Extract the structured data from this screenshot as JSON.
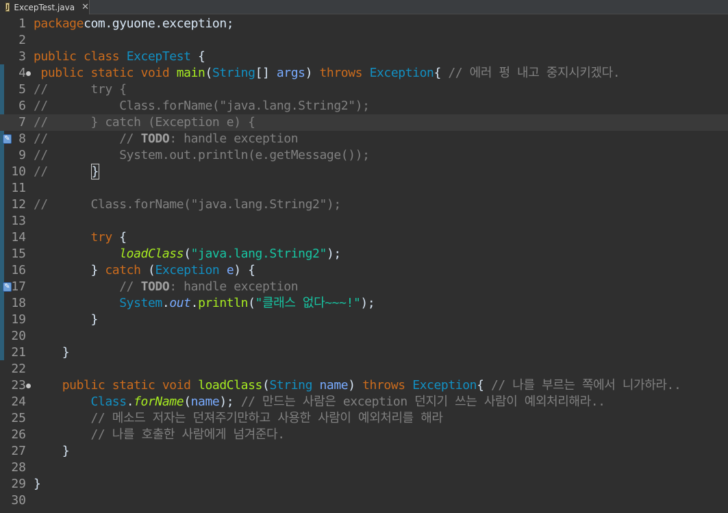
{
  "tab": {
    "title": "ExcepTest.java",
    "close": "✕",
    "icon": "J"
  },
  "lines": [
    {
      "n": "1",
      "t": [
        [
          "kw",
          "package"
        ],
        [
          "",
          "com.gyuone.exception;"
        ]
      ]
    },
    {
      "n": "2",
      "t": []
    },
    {
      "n": "3",
      "t": [
        [
          "kw",
          "public class"
        ],
        [
          "",
          " "
        ],
        [
          "cl",
          "ExcepTest"
        ],
        [
          "",
          " {"
        ]
      ]
    },
    {
      "n": "4",
      "fold": true,
      "t": [
        [
          "",
          " "
        ],
        [
          "kw",
          "public static void"
        ],
        [
          "",
          " "
        ],
        [
          "mt",
          "main"
        ],
        [
          "",
          "("
        ],
        [
          "cl",
          "String"
        ],
        [
          "",
          "[] "
        ],
        [
          "pm",
          "args"
        ],
        [
          "",
          ") "
        ],
        [
          "kw",
          "throws"
        ],
        [
          "",
          " "
        ],
        [
          "cl",
          "Exception"
        ],
        [
          "",
          "{ "
        ],
        [
          "cm",
          "// 에러 펑 내고 중지시키겠다."
        ]
      ]
    },
    {
      "n": "5",
      "t": [
        [
          "cm",
          "//      try {"
        ]
      ]
    },
    {
      "n": "6",
      "t": [
        [
          "cm",
          "//          Class.forName(\"java.lang.String2\");"
        ]
      ]
    },
    {
      "n": "7",
      "current": true,
      "t": [
        [
          "cm",
          "//      } catch (Exception e) {"
        ]
      ]
    },
    {
      "n": "8",
      "marker": true,
      "t": [
        [
          "cm",
          "//          // "
        ],
        [
          "todo",
          "TODO"
        ],
        [
          "cm",
          ": handle exception"
        ]
      ]
    },
    {
      "n": "9",
      "t": [
        [
          "cm",
          "//          System.out.println(e.getMessage());"
        ]
      ]
    },
    {
      "n": "10",
      "t": [
        [
          "cm",
          "//      "
        ],
        [
          "caret",
          "}"
        ]
      ]
    },
    {
      "n": "11",
      "t": []
    },
    {
      "n": "12",
      "t": [
        [
          "cm",
          "//      Class.forName(\"java.lang.String2\");"
        ]
      ]
    },
    {
      "n": "13",
      "t": []
    },
    {
      "n": "14",
      "t": [
        [
          "",
          "        "
        ],
        [
          "kw",
          "try"
        ],
        [
          "",
          " {"
        ]
      ]
    },
    {
      "n": "15",
      "t": [
        [
          "",
          "            "
        ],
        [
          "mt it",
          "loadClass"
        ],
        [
          "",
          "("
        ],
        [
          "st",
          "\"java.lang.String2\""
        ],
        [
          "",
          ");"
        ]
      ]
    },
    {
      "n": "16",
      "t": [
        [
          "",
          "        } "
        ],
        [
          "kw",
          "catch"
        ],
        [
          "",
          " ("
        ],
        [
          "cl",
          "Exception"
        ],
        [
          "",
          " "
        ],
        [
          "pm",
          "e"
        ],
        [
          "",
          ") {"
        ]
      ]
    },
    {
      "n": "17",
      "marker": true,
      "t": [
        [
          "",
          "            "
        ],
        [
          "cm",
          "// "
        ],
        [
          "todo",
          "TODO"
        ],
        [
          "cm",
          ": handle exception"
        ]
      ]
    },
    {
      "n": "18",
      "t": [
        [
          "",
          "            "
        ],
        [
          "cl",
          "System"
        ],
        [
          "",
          "."
        ],
        [
          "pm it",
          "out"
        ],
        [
          "",
          "."
        ],
        [
          "mt",
          "println"
        ],
        [
          "",
          "("
        ],
        [
          "st",
          "\"클래스 없다~~~!\""
        ],
        [
          "",
          ");"
        ]
      ]
    },
    {
      "n": "19",
      "t": [
        [
          "",
          "        }"
        ]
      ]
    },
    {
      "n": "20",
      "t": []
    },
    {
      "n": "21",
      "t": [
        [
          "",
          "    }"
        ]
      ]
    },
    {
      "n": "22",
      "t": []
    },
    {
      "n": "23",
      "fold": true,
      "t": [
        [
          "",
          "    "
        ],
        [
          "kw",
          "public static void"
        ],
        [
          "",
          " "
        ],
        [
          "mt",
          "loadClass"
        ],
        [
          "",
          "("
        ],
        [
          "cl",
          "String"
        ],
        [
          "",
          " "
        ],
        [
          "pm",
          "name"
        ],
        [
          "",
          ") "
        ],
        [
          "kw",
          "throws"
        ],
        [
          "",
          " "
        ],
        [
          "cl",
          "Exception"
        ],
        [
          "",
          "{ "
        ],
        [
          "cm",
          "// 나를 부르는 쪽에서 니가하라.."
        ]
      ]
    },
    {
      "n": "24",
      "t": [
        [
          "",
          "        "
        ],
        [
          "cl",
          "Class"
        ],
        [
          "",
          "."
        ],
        [
          "mt it",
          "forName"
        ],
        [
          "",
          "("
        ],
        [
          "pm",
          "name"
        ],
        [
          "",
          "); "
        ],
        [
          "cm",
          "// 만드는 사람은 exception 던지기 쓰는 사람이 예외처리해라.."
        ]
      ]
    },
    {
      "n": "25",
      "t": [
        [
          "",
          "        "
        ],
        [
          "cm",
          "// 메소드 저자는 던져주기만하고 사용한 사람이 예외처리를 해라"
        ]
      ]
    },
    {
      "n": "26",
      "t": [
        [
          "",
          "        "
        ],
        [
          "cm",
          "// 나를 호출한 사람에게 넘겨준다."
        ]
      ]
    },
    {
      "n": "27",
      "t": [
        [
          "",
          "    }"
        ]
      ]
    },
    {
      "n": "28",
      "t": []
    },
    {
      "n": "29",
      "t": [
        [
          "",
          "}"
        ]
      ]
    },
    {
      "n": "30",
      "t": []
    }
  ]
}
